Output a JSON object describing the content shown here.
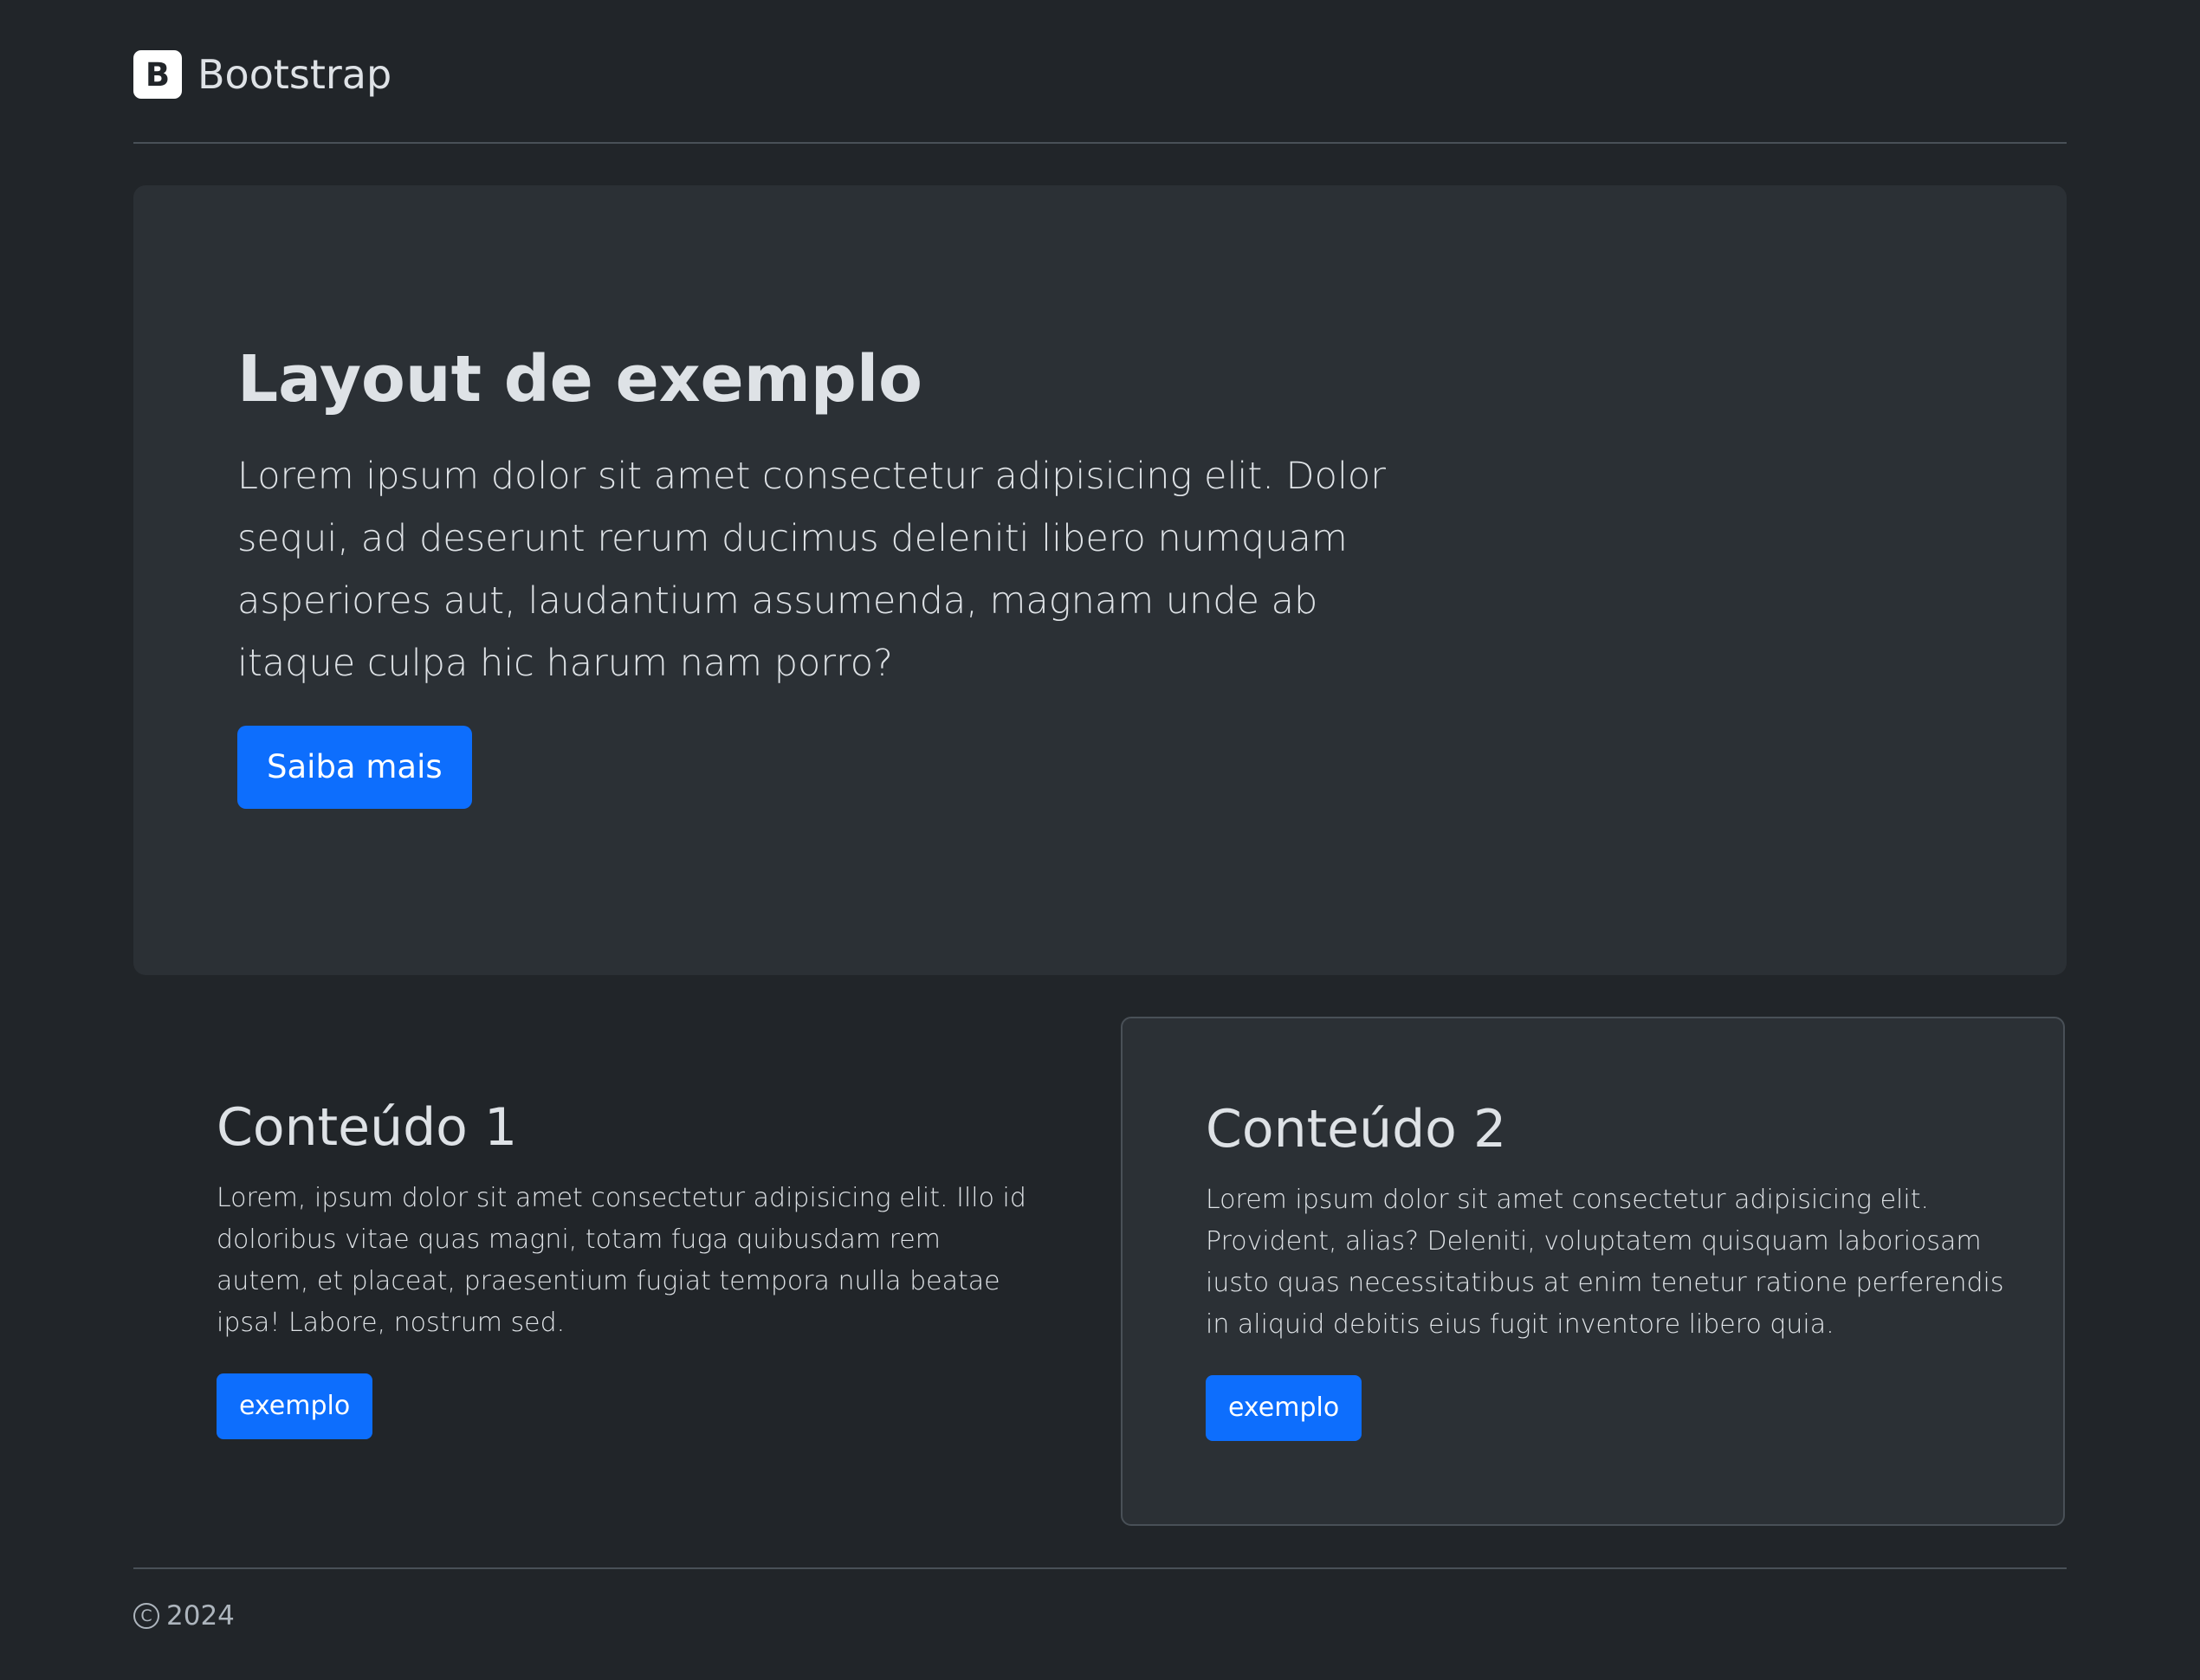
{
  "header": {
    "logo_letter": "B",
    "brand": "Bootstrap"
  },
  "hero": {
    "title": "Layout de exemplo",
    "text": "Lorem ipsum dolor sit amet consectetur adipisicing elit. Dolor sequi, ad deserunt rerum ducimus deleniti libero numquam asperiores aut, laudantium assumenda, magnam unde ab itaque culpa hic harum nam porro?",
    "button_label": "Saiba mais"
  },
  "columns": [
    {
      "title": "Conteúdo 1",
      "text": "Lorem, ipsum dolor sit amet consectetur adipisicing elit. Illo id doloribus vitae quas magni, totam fuga quibusdam rem autem, et placeat, praesentium fugiat tempora nulla beatae ipsa! Labore, nostrum sed.",
      "button_label": "exemplo"
    },
    {
      "title": "Conteúdo 2",
      "text": "Lorem ipsum dolor sit amet consectetur adipisicing elit. Provident, alias? Deleniti, voluptatem quisquam laboriosam iusto quas necessitatibus at enim tenetur ratione perferendis in aliquid debitis eius fugit inventore libero quia.",
      "button_label": "exemplo"
    }
  ],
  "footer": {
    "copyright_symbol": "C",
    "year": "2024"
  },
  "colors": {
    "background": "#212529",
    "panel": "#2b3035",
    "primary": "#0d6efd",
    "border": "#495057",
    "text": "#dee2e6"
  },
  "icons": {
    "brand": "bootstrap-logo-icon",
    "copyright": "copyright-icon"
  }
}
